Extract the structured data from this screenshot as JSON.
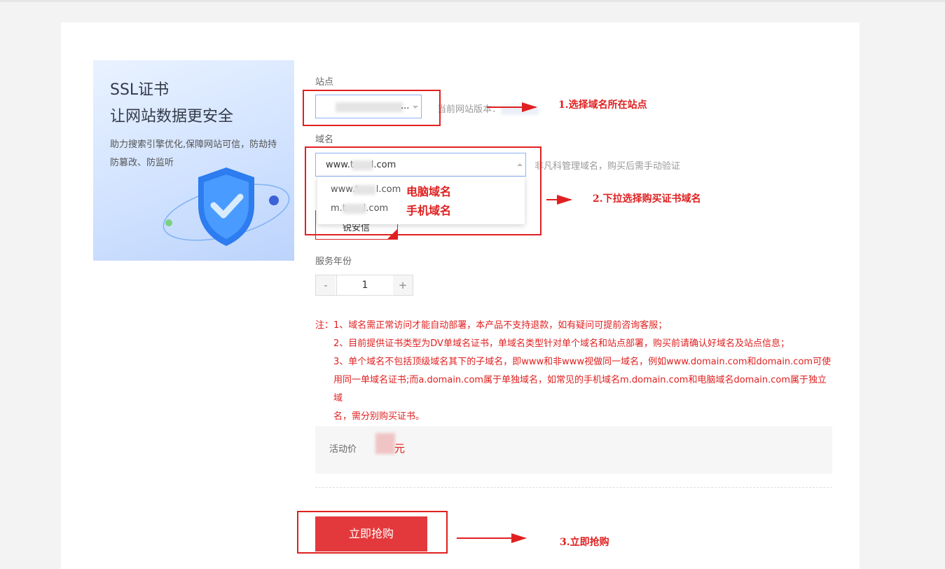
{
  "promo": {
    "title": "SSL证书",
    "subtitle": "让网站数据更安全",
    "description": "助力搜索引擎优化,保障网站可信，防劫持防篡改、防监听"
  },
  "form": {
    "site_label": "站点",
    "site_value": "...",
    "site_hint": "当前网站版本：",
    "domain_label": "域名",
    "domain_value": "www.t      l.com",
    "domain_hint": "非凡科管理域名，购买后需手动验证",
    "domain_options": [
      {
        "value": "www.t      l.com",
        "tag": "电脑域名"
      },
      {
        "value": "m.t      l.com",
        "tag": "手机域名"
      }
    ],
    "hidden_option_text": "锐安信",
    "years_label": "服务年份",
    "years_minus": "-",
    "years_value": "1",
    "years_plus": "+"
  },
  "notes": {
    "line1": "注：1、域名需正常访问才能自动部署，本产品不支持退款，如有疑问可提前咨询客服；",
    "line2": "2、目前提供证书类型为DV单域名证书，单域名类型针对单个域名和站点部署，购买前请确认好域名及站点信息；",
    "line3a": "3、单个域名不包括顶级域名其下的子域名，即www和非www视做同一域名，例如www.domain.com和domain.com可使",
    "line3b": "用同一单域名证书;而a.domain.com属于单独域名，如常见的手机域名m.domain.com和电脑域名domain.com属于独立域",
    "line3c": "名，需分别购买证书。"
  },
  "price": {
    "label": "活动价",
    "unit": "元"
  },
  "buy_button": "立即抢购",
  "annotations": {
    "step1": "1.选择域名所在站点",
    "step2": "2.下拉选择购买证书域名",
    "step3": "3.立即抢购"
  },
  "colors": {
    "accent_red": "#e02020",
    "buy_button": "#e4393c",
    "select_border": "#8db3f6"
  }
}
